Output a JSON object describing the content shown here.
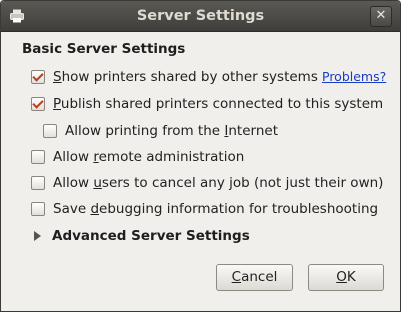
{
  "window": {
    "title": "Server Settings"
  },
  "section": {
    "heading": "Basic Server Settings"
  },
  "options": [
    {
      "prefix": "",
      "mnemonic": "S",
      "rest": "how printers shared by other systems",
      "checked": true
    },
    {
      "prefix": "",
      "mnemonic": "P",
      "rest": "ublish shared printers connected to this system",
      "checked": true
    },
    {
      "prefix": "Allow printing from the ",
      "mnemonic": "I",
      "rest": "nternet",
      "checked": false
    },
    {
      "prefix": "Allow ",
      "mnemonic": "r",
      "rest": "emote administration",
      "checked": false
    },
    {
      "prefix": "Allow ",
      "mnemonic": "u",
      "rest": "sers to cancel any job (not just their own)",
      "checked": false
    },
    {
      "prefix": "Save ",
      "mnemonic": "d",
      "rest": "ebugging information for troubleshooting",
      "checked": false
    }
  ],
  "problems_link": "Problems?",
  "advanced": {
    "label": "Advanced Server Settings"
  },
  "buttons": {
    "cancel": {
      "mnemonic": "C",
      "rest": "ancel"
    },
    "ok": {
      "mnemonic": "O",
      "rest": "K"
    }
  },
  "icons": {
    "window_icon": "printer-icon",
    "close": "close-icon",
    "expander": "triangle-right-icon"
  }
}
